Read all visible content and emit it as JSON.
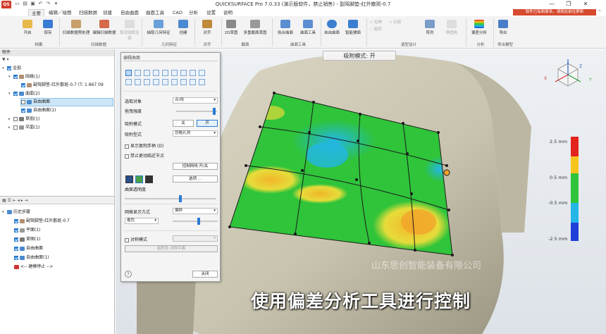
{
  "titlebar": {
    "logo": "QS",
    "title": "QUICKSURFACE Pro 7.0.33 (演示版软件，禁止销售) - 副驾脚垫-红外散斑-0.7",
    "window_controls": [
      "—",
      "❐",
      "✕"
    ]
  },
  "menu": {
    "tabs": [
      "主要",
      "编辑／绘图",
      "扫描数据",
      "创建",
      "自由曲面",
      "曲面工具",
      "CAD",
      "分析",
      "设置",
      "说明"
    ],
    "active": "主要",
    "notice": "软件已有新版本，请按此前往更新"
  },
  "ribbon": {
    "buttons": [
      {
        "label": "开启",
        "icon": "folder-open-icon"
      },
      {
        "label": "保存",
        "icon": "save-icon"
      },
      {
        "label": "扫描数据预处理",
        "icon": "scan-preprocess-icon"
      },
      {
        "label": "编辑扫描数据",
        "icon": "edit-scan-icon"
      },
      {
        "label": "取消选取全部",
        "icon": "deselect-icon"
      },
      {
        "label": "抽取几何特征",
        "icon": "extract-feature-icon"
      },
      {
        "label": "创建",
        "icon": "create-icon"
      },
      {
        "label": "对齐",
        "icon": "align-icon"
      },
      {
        "label": "2D草图",
        "icon": "sketch-icon"
      },
      {
        "label": "多重截面草图",
        "icon": "multi-section-icon"
      },
      {
        "label": "拟合曲面",
        "icon": "fit-surface-icon"
      },
      {
        "label": "曲面工具",
        "icon": "surface-tools-icon"
      },
      {
        "label": "自由曲面",
        "icon": "freeform-icon"
      },
      {
        "label": "智能铺面",
        "icon": "smart-surface-icon"
      },
      {
        "label": "拉伸",
        "icon": "extrude-icon"
      },
      {
        "label": "旋转",
        "icon": "revolve-icon"
      },
      {
        "label": "扫掠",
        "icon": "sweep-icon"
      },
      {
        "label": "阵列",
        "icon": "pattern-icon"
      },
      {
        "label": "倒圆角",
        "icon": "fillet-icon"
      },
      {
        "label": "偏差分析",
        "icon": "deviation-icon"
      },
      {
        "label": "导出",
        "icon": "export-icon"
      }
    ],
    "groups": [
      "档案",
      "扫描数据",
      "几何特征",
      "对齐",
      "截面",
      "曲面工具",
      "造型设计",
      "分析",
      "导出模型"
    ]
  },
  "left_panel": {
    "objects_header": "物件",
    "tree": [
      {
        "label": "全部",
        "indent": 0,
        "checked": true
      },
      {
        "label": "网格(1)",
        "indent": 1,
        "checked": true
      },
      {
        "label": "副驾脚垫-红外散斑-0.7 (T: 1 867 09",
        "indent": 2,
        "checked": true
      },
      {
        "label": "曲面(2)",
        "indent": 1,
        "checked": true
      },
      {
        "label": "自由曲面",
        "indent": 2,
        "checked": false,
        "selected": true
      },
      {
        "label": "自由曲面(1)",
        "indent": 2,
        "checked": true
      },
      {
        "label": "草图(1)",
        "indent": 1,
        "checked": false
      },
      {
        "label": "平面(1)",
        "indent": 1,
        "checked": false
      }
    ],
    "history_header": "历史步骤",
    "history": [
      {
        "label": "副驾脚垫-红外散斑-0.7",
        "checked": true
      },
      {
        "label": "平面(1)",
        "checked": true
      },
      {
        "label": "草图(1)",
        "checked": true
      },
      {
        "label": "自由曲面",
        "checked": true
      },
      {
        "label": "自由曲面(1)",
        "checked": true
      },
      {
        "label": "<-- 建模停止 -->",
        "checked": false
      }
    ]
  },
  "dialog": {
    "title": "编辑曲面",
    "select_label": "选取对象",
    "select_value": "点/线",
    "drag_label": "拖曳强度",
    "snap_label": "吸附模式",
    "snap_off": "关",
    "snap_on": "开",
    "snap_type_label": "吸附型式",
    "snap_type_value": "忽略孔洞",
    "show_handles": "显示复制手柄 (D)",
    "disable_edge": "禁止更动临近节点",
    "control_grid": "控制网线 开/关",
    "options": "选项 ...",
    "transparency_label": "曲面透明度",
    "grid_display_label": "网格显示方式",
    "grid_display_value": "偏移",
    "color_label": "着色",
    "symmetry_label": "对称模式",
    "symmetry_btn": "贴附至 对称平面",
    "close": "关闭",
    "help": "?"
  },
  "viewport": {
    "snap_banner": "吸附模式: 开",
    "legend_labels": [
      "2.5 mm",
      "0.5 mm",
      "-0.5 mm",
      "-2.5 mm"
    ],
    "legend_colors": [
      "#e3241c",
      "#f5c51c",
      "#2fc43a",
      "#23b6e6",
      "#1f3fd8"
    ],
    "watermark": "山东思创智能装备有限公司",
    "subtitle": "使用偏差分析工具进行控制",
    "axis_labels": [
      "Z",
      "X",
      "Y"
    ]
  }
}
